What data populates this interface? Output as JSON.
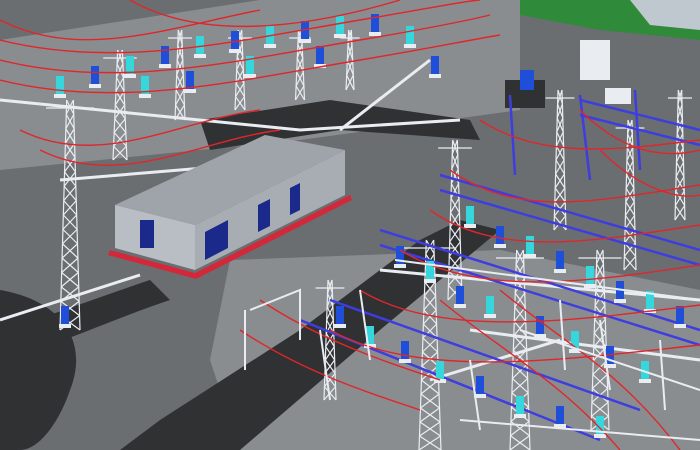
{
  "scene": {
    "kind": "3D substation model rendering",
    "colors": {
      "ground": "#6b6e71",
      "ground_light": "#8a8d90",
      "road": "#2f3133",
      "grass": "#2f8a3a",
      "sky_corner": "#bfc7cf",
      "conductor": "#e0262a",
      "busbar_blue": "#3d3de0",
      "steel_white": "#e9edf2",
      "equipment_cyan": "#35d6dc",
      "equipment_blue": "#1f4fd8",
      "building_wall": "#b9bec4",
      "building_roof": "#9ea4aa",
      "door_navy": "#1b2a8a",
      "fence_red": "#d2283a"
    },
    "objects": [
      "control-building",
      "substation-yard",
      "lattice-tower",
      "transformer",
      "bus-gantry",
      "access-road",
      "overhead-conductor"
    ]
  }
}
